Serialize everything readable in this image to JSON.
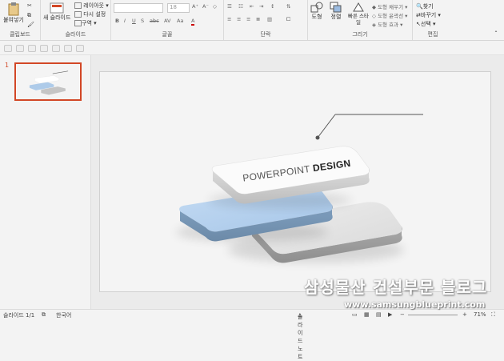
{
  "ribbon": {
    "clipboard": {
      "paste": "붙여넣기",
      "label": "클립보드"
    },
    "slides": {
      "new_slide": "새 슬라이드",
      "layout": "레이아웃",
      "reset": "다시 설정",
      "section": "구역",
      "label": "슬라이드"
    },
    "font": {
      "font_size": "18",
      "label": "글꼴"
    },
    "paragraph": {
      "label": "단락"
    },
    "drawing": {
      "shapes": "도형",
      "arrange": "정렬",
      "quick_styles": "빠른 스타일",
      "shape_fill": "도형 채우기",
      "shape_outline": "도형 윤곽선",
      "shape_effects": "도형 효과",
      "label": "그리기"
    },
    "editing": {
      "find": "찾기",
      "replace": "바꾸기",
      "select": "선택",
      "label": "편집"
    }
  },
  "thumbnail": {
    "number": "1"
  },
  "slide": {
    "text_regular": "POWERPOINT ",
    "text_bold": "DESIGN"
  },
  "status": {
    "slide_count": "슬라이드 1/1",
    "language": "한국어",
    "notes": "슬라이드 노트",
    "zoom": "71%"
  },
  "watermark": {
    "title": "삼성물산 건설부문 블로그",
    "url": "www.samsungblueprint.com"
  },
  "colors": {
    "accent": "#d24726",
    "blue_card": "#b9d3ee",
    "gray_card": "#c8c8c8"
  }
}
